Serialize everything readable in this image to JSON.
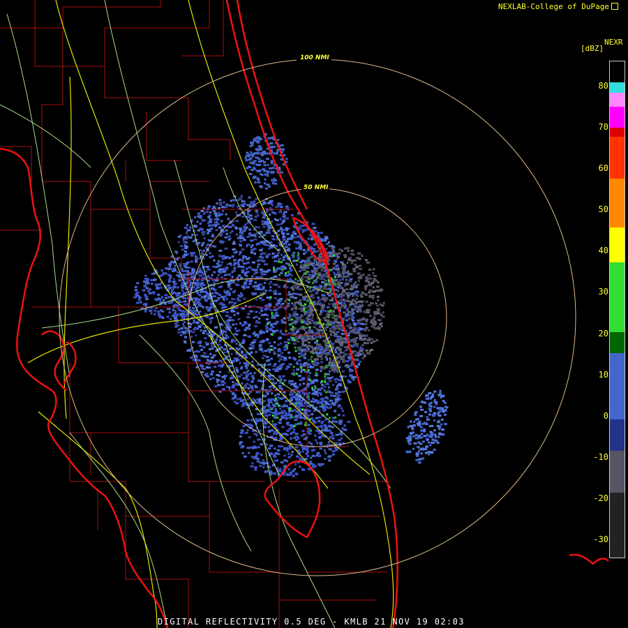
{
  "header": {
    "credit": "NEXLAB-College of DuPage",
    "credit_icon": "external-link-icon",
    "product": "NEXR",
    "units": "[dBZ]"
  },
  "range_rings": [
    {
      "label": "100 NMI"
    },
    {
      "label": "50 NMI"
    }
  ],
  "legend": {
    "ticks": [
      "80",
      "70",
      "60",
      "50",
      "40",
      "30",
      "20",
      "10",
      "0",
      "-10",
      "-20",
      "-30"
    ],
    "colors": {
      "coast": "#ee1111",
      "county_lines": "#aa1111",
      "highways": "#e6e600",
      "roads": "#aadd88",
      "range_rings": "#ddbb88"
    },
    "scale_colors": [
      "#000000",
      "#33dddd",
      "#ff88ff",
      "#ff00ff",
      "#dd0000",
      "#ff3300",
      "#ff8800",
      "#ffff00",
      "#33dd33",
      "#006600",
      "#4466cc",
      "#223388",
      "#555566",
      "#222222"
    ]
  },
  "footer": {
    "caption": "DIGITAL REFLECTIVITY 0.5 DEG - KMLB 21 NOV 19 02:03"
  }
}
